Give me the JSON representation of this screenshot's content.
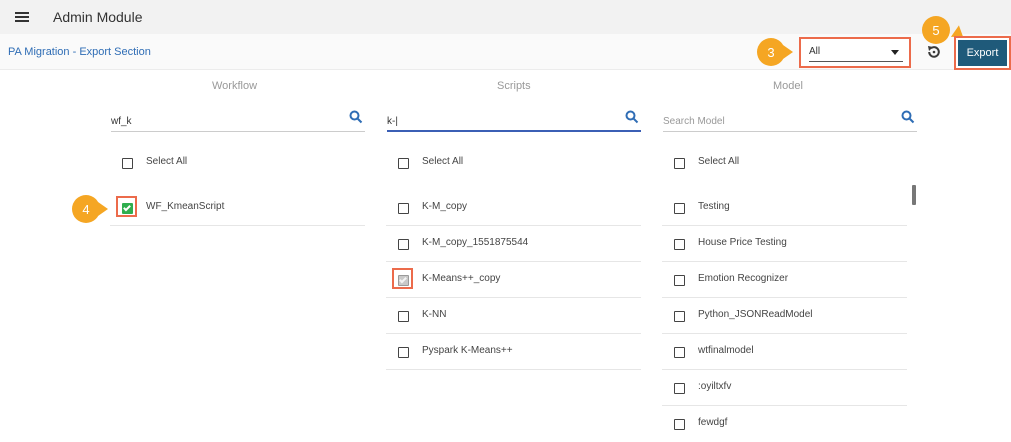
{
  "header": {
    "title": "Admin Module",
    "icon": "hamburger-menu-icon"
  },
  "breadcrumb": "PA Migration - Export Section",
  "callouts": {
    "c3": "3",
    "c4": "4",
    "c5": "5"
  },
  "callout_color": "#f5a623",
  "highlight_color": "#ec6b4b",
  "filter": {
    "selected": "All"
  },
  "export_label": "Export",
  "columns": {
    "workflow": {
      "header": "Workflow",
      "search_value": "wf_k",
      "select_all": "Select All",
      "items": [
        {
          "label": "WF_KmeanScript",
          "checked": true
        }
      ]
    },
    "scripts": {
      "header": "Scripts",
      "search_value": "k-|",
      "select_all": "Select All",
      "items": [
        {
          "label": "K-M_copy",
          "checked": false
        },
        {
          "label": "K-M_copy_1551875544",
          "checked": false
        },
        {
          "label": "K-Means++_copy",
          "checked": true
        },
        {
          "label": "K-NN",
          "checked": false
        },
        {
          "label": "Pyspark K-Means++",
          "checked": false
        }
      ]
    },
    "model": {
      "header": "Model",
      "search_placeholder": "Search Model",
      "select_all": "Select All",
      "items": [
        {
          "label": "Testing",
          "checked": false
        },
        {
          "label": "House Price Testing",
          "checked": false
        },
        {
          "label": "Emotion Recognizer",
          "checked": false
        },
        {
          "label": "Python_JSONReadModel",
          "checked": false
        },
        {
          "label": "wtfinalmodel",
          "checked": false
        },
        {
          "label": ":oyiltxfv",
          "checked": false
        },
        {
          "label": "fewdgf",
          "checked": false
        }
      ]
    }
  }
}
